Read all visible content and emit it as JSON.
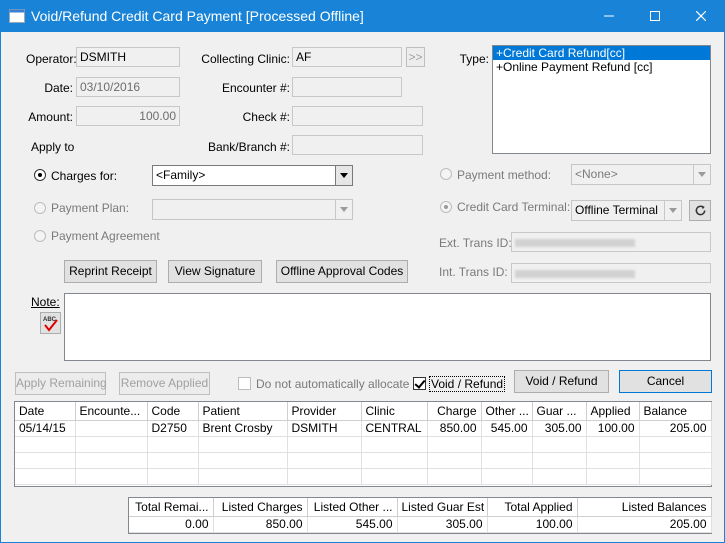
{
  "window": {
    "title": "Void/Refund Credit Card Payment [Processed Offline]"
  },
  "form": {
    "operator_label": "Operator:",
    "operator_value": "DSMITH",
    "date_label": "Date:",
    "date_value": "03/10/2016",
    "amount_label": "Amount:",
    "amount_value": "100.00",
    "apply_to_label": "Apply to",
    "collecting_clinic_label": "Collecting Clinic:",
    "collecting_clinic_value": "AF",
    "clinic_picker_label": ">>",
    "encounter_label": "Encounter #:",
    "encounter_value": "",
    "check_label": "Check #:",
    "check_value": "",
    "bank_branch_label": "Bank/Branch #:",
    "bank_branch_value": "",
    "type_label": "Type:",
    "type_options": [
      "+Credit Card Refund[cc]",
      "+Online Payment Refund [cc]"
    ],
    "charges_for_label": "Charges for:",
    "charges_for_value": "<Family>",
    "payment_plan_label": "Payment Plan:",
    "payment_plan_value": "",
    "payment_agreement_label": "Payment Agreement",
    "payment_method_label": "Payment method:",
    "payment_method_value": "<None>",
    "cc_terminal_label": "Credit Card Terminal:",
    "cc_terminal_value": "Offline Terminal",
    "ext_trans_label": "Ext. Trans ID:",
    "int_trans_label": "Int. Trans ID:",
    "note_label": "Note:",
    "note_value": ""
  },
  "buttons": {
    "reprint_receipt": "Reprint Receipt",
    "view_signature": "View Signature",
    "offline_approval": "Offline Approval Codes",
    "apply_remaining": "Apply Remaining",
    "remove_applied": "Remove Applied",
    "void_refund": "Void / Refund",
    "cancel": "Cancel"
  },
  "options": {
    "do_not_allocate": "Do not automatically allocate",
    "void_refund_check": "Void / Refund"
  },
  "grid": {
    "columns": [
      "Date",
      "Encounte...",
      "Code",
      "Patient",
      "Provider",
      "Clinic",
      "Charge",
      "Other ...",
      "Guar ...",
      "Applied",
      "Balance"
    ],
    "rows": [
      [
        "05/14/15",
        "",
        "D2750",
        "Brent Crosby",
        "DSMITH",
        "CENTRAL",
        "850.00",
        "545.00",
        "305.00",
        "100.00",
        "205.00"
      ]
    ]
  },
  "totals": {
    "columns": [
      "Total Remai...",
      "Listed Charges",
      "Listed Other ...",
      "Listed Guar Est",
      "Total Applied",
      "Listed Balances"
    ],
    "values": [
      "0.00",
      "850.00",
      "545.00",
      "305.00",
      "100.00",
      "205.00"
    ]
  },
  "colors": {
    "titlebar": "#1883d7",
    "selection": "#0078d7",
    "window_bg": "#f0f0f0"
  }
}
